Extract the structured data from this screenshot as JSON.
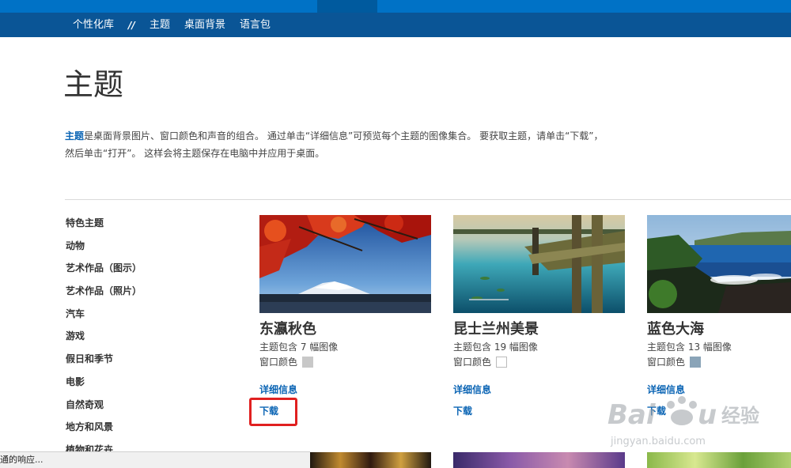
{
  "nav": {
    "items": [
      "个性化库",
      "//",
      "主题",
      "桌面背景",
      "语言包"
    ]
  },
  "page": {
    "title": "主题",
    "intro_link": "主题",
    "intro_text1": "是桌面背景图片、窗口颜色和声音的组合。 通过单击“详细信息”可预览每个主题的图像集合。 要获取主题，请单击“下载”，",
    "intro_text2": "然后单击“打开”。 这样会将主题保存在电脑中并应用于桌面。"
  },
  "sidebar": {
    "items": [
      "特色主题",
      "动物",
      "艺术作品（图示）",
      "艺术作品（照片）",
      "汽车",
      "游戏",
      "假日和季节",
      "电影",
      "自然奇观",
      "地方和风景",
      "植物和花卉"
    ]
  },
  "cards": [
    {
      "title": "东瀛秋色",
      "count": "主题包含 7 幅图像",
      "color_label": "窗口颜色",
      "swatch": "#c8c8c8",
      "details": "详细信息",
      "download": "下载"
    },
    {
      "title": "昆士兰州美景",
      "count": "主题包含 19 幅图像",
      "color_label": "窗口颜色",
      "swatch": "#ffffff",
      "details": "详细信息",
      "download": "下载"
    },
    {
      "title": "蓝色大海",
      "count": "主题包含 13 幅图像",
      "color_label": "窗口颜色",
      "swatch": "#8aa4b8",
      "details": "详细信息",
      "download": "下载"
    }
  ],
  "status": {
    "text": "通的响应..."
  },
  "watermark": {
    "brand": "Baidu经验",
    "url": "jingyan.baidu.com"
  },
  "colors": {
    "accent": "#0072c6",
    "nav": "#0a5596",
    "link": "#0a64b4",
    "highlight": "#e02020"
  }
}
